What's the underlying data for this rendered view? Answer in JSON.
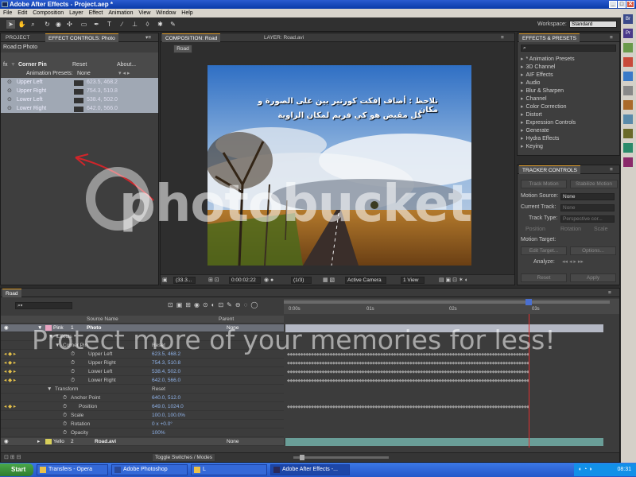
{
  "window": {
    "title": "Adobe After Effects - Project.aep *",
    "controls": [
      "_",
      "□",
      "✕"
    ]
  },
  "menu": [
    "File",
    "Edit",
    "Composition",
    "Layer",
    "Effect",
    "Animation",
    "View",
    "Window",
    "Help"
  ],
  "toolbar": {
    "workspace_label": "Workspace:",
    "workspace_value": "Standard"
  },
  "left_panel": {
    "tabs": [
      "PROJECT",
      "EFFECT CONTROLS: Photo"
    ],
    "breadcrumb": "Road ◘ Photo",
    "effect": {
      "fx": "fx",
      "name": "Corner Pin",
      "reset": "Reset",
      "about": "About..."
    },
    "presets_label": "Animation Presets:",
    "presets_value": "None",
    "params": [
      {
        "label": "Upper Left",
        "value": "623.5, 468.2"
      },
      {
        "label": "Upper Right",
        "value": "754.3, 510.8"
      },
      {
        "label": "Lower Left",
        "value": "538.4, 502.0"
      },
      {
        "label": "Lower Right",
        "value": "642.0, 566.0"
      }
    ]
  },
  "comp_panel": {
    "tabs": [
      "COMPOSITION: Road",
      "LAYER: Road.avi"
    ],
    "crumb": "Road",
    "arabic_note_line1": "نلاحظ : أضاف إفكت كورنير بين على الصورة و مكان",
    "arabic_note_line2": "كل مقبض هو كي فريم لمكان الزاوية",
    "footer": {
      "zoom": "(33.3...",
      "time": "0:00:02:22",
      "resolution": "(1/3)",
      "camera": "Active Camera",
      "view": "1 View"
    }
  },
  "effects_panel": {
    "title": "EFFECTS & PRESETS",
    "items": [
      "* Animation Presets",
      "3D Channel",
      "AIF Effects",
      "Audio",
      "Blur & Sharpen",
      "Channel",
      "Color Correction",
      "Distort",
      "Expression Controls",
      "Generate",
      "Hydra Effects",
      "Keying"
    ]
  },
  "tracker_panel": {
    "title": "TRACKER CONTROLS",
    "track_motion": "Track Motion",
    "stabilize_motion": "Stabilize Motion",
    "motion_source_label": "Motion Source:",
    "motion_source_value": "None",
    "current_track_label": "Current Track:",
    "current_track_value": "None",
    "track_type_label": "Track Type:",
    "track_type_value": "Perspective cor...",
    "position": "Position",
    "rotation": "Rotation",
    "scale": "Scale",
    "motion_target_label": "Motion Target:",
    "edit_target": "Edit Target...",
    "options": "Options...",
    "analyze_label": "Analyze:",
    "reset": "Reset",
    "apply": "Apply"
  },
  "timeline": {
    "tab": "Road",
    "columns": {
      "source": "Source Name",
      "parent": "Parent"
    },
    "ruler": [
      "0:00s",
      "01s",
      "02s",
      "03s"
    ],
    "layer1": {
      "color": "Pink",
      "index": "1",
      "name": "Photo",
      "parent": "None"
    },
    "effects_label": "Effects",
    "corner_pin": {
      "name": "Corner Pin",
      "reset": "Reset"
    },
    "pins": [
      {
        "label": "Upper Left",
        "value": "623.5, 468.2"
      },
      {
        "label": "Upper Right",
        "value": "754.3, 510.8"
      },
      {
        "label": "Lower Left",
        "value": "538.4, 502.0"
      },
      {
        "label": "Lower Right",
        "value": "642.0, 566.0"
      }
    ],
    "transform": {
      "name": "Transform",
      "reset": "Reset"
    },
    "props": [
      {
        "label": "Anchor Point",
        "value": "640.0, 512.0"
      },
      {
        "label": "Position",
        "value": "649.0, 1024.0"
      },
      {
        "label": "Scale",
        "value": "100.0, 100.0%"
      },
      {
        "label": "Rotation",
        "value": "0 x +0.0°"
      },
      {
        "label": "Opacity",
        "value": "100%"
      }
    ],
    "layer2": {
      "color": "Yello",
      "index": "2",
      "name": "Road.avi",
      "parent": "None"
    },
    "toggle_label": "Toggle Switches / Modes"
  },
  "taskbar": {
    "start": "Start",
    "items": [
      "Transfers - Opera",
      "Adobe Photoshop",
      "L",
      "Adobe After Effects -..."
    ],
    "clock": "08:31"
  },
  "watermark": {
    "brand": "photobucket",
    "tagline": "Protect more of your memories for less!"
  },
  "colors": {
    "accent": "#e0a030",
    "playhead": "#e03030",
    "selected_param": "#9aa4b0",
    "annotation_arrow": "#d0252a"
  }
}
